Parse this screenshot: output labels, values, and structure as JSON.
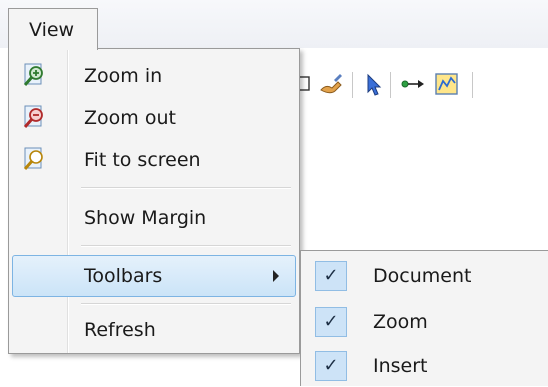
{
  "menubar": {
    "view_label": "View"
  },
  "view_menu": {
    "items": [
      {
        "label": "Zoom in",
        "icon": "zoom-in-icon"
      },
      {
        "label": "Zoom out",
        "icon": "zoom-out-icon"
      },
      {
        "label": "Fit to screen",
        "icon": "fit-to-screen-icon"
      },
      {
        "label": "Show Margin"
      },
      {
        "label": "Toolbars",
        "has_submenu": true,
        "highlighted": true
      },
      {
        "label": "Refresh"
      }
    ]
  },
  "toolbars_submenu": {
    "items": [
      {
        "label": "Document",
        "checked": true
      },
      {
        "label": "Zoom",
        "checked": true
      },
      {
        "label": "Insert",
        "checked": true
      }
    ]
  },
  "colors": {
    "highlight": "#cbe4f8",
    "highlight_border": "#7db4e3",
    "menu_bg": "#f4f4f4"
  }
}
